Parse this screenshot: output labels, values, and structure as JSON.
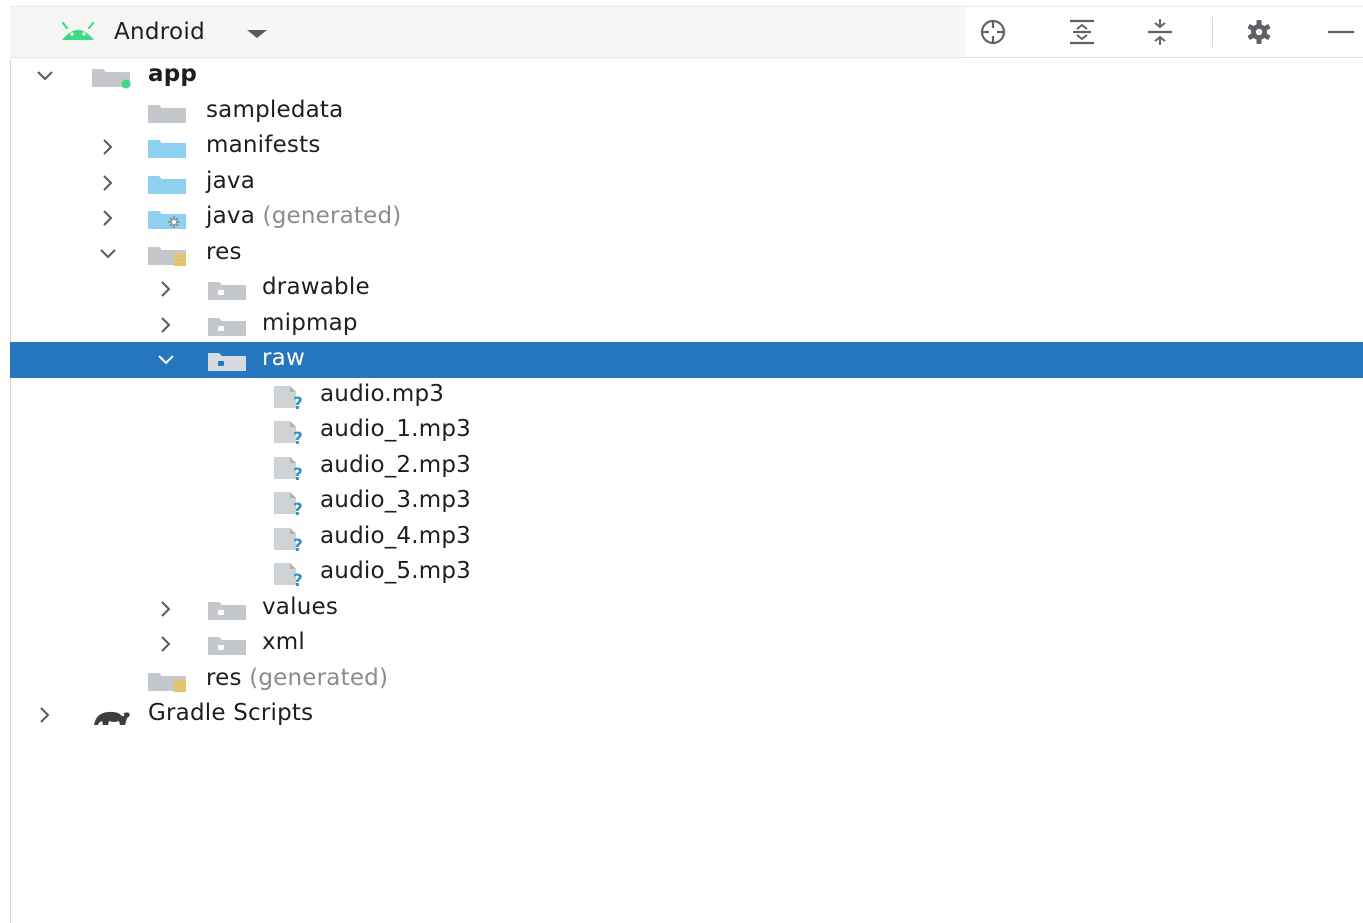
{
  "toolbar": {
    "view_selector_label": "Android",
    "icons": {
      "android": "android-icon",
      "locate": "locate-icon",
      "expand_all": "expand-all-icon",
      "collapse_all": "collapse-all-icon",
      "settings": "gear-icon",
      "hide": "minimize-icon"
    }
  },
  "colors": {
    "selection": "#2675bf",
    "android_green": "#3ddc84",
    "folder_blue": "#8dd0ef",
    "folder_gray": "#c4c8cc",
    "res_accent": "#f1c34c",
    "unknown_file_blue": "#3592c4"
  },
  "tree": {
    "items": [
      {
        "label": "app",
        "suffix": "",
        "depth": 0,
        "expanded": true,
        "icon": "module-folder-icon",
        "bold": true
      },
      {
        "label": "sampledata",
        "suffix": "",
        "depth": 1,
        "expanded": null,
        "icon": "folder-icon"
      },
      {
        "label": "manifests",
        "suffix": "",
        "depth": 1,
        "expanded": false,
        "icon": "source-folder-icon"
      },
      {
        "label": "java",
        "suffix": "",
        "depth": 1,
        "expanded": false,
        "icon": "source-folder-icon"
      },
      {
        "label": "java",
        "suffix": "(generated)",
        "depth": 1,
        "expanded": false,
        "icon": "generated-folder-icon"
      },
      {
        "label": "res",
        "suffix": "",
        "depth": 1,
        "expanded": true,
        "icon": "resource-folder-icon"
      },
      {
        "label": "drawable",
        "suffix": "",
        "depth": 2,
        "expanded": false,
        "icon": "package-folder-icon"
      },
      {
        "label": "mipmap",
        "suffix": "",
        "depth": 2,
        "expanded": false,
        "icon": "package-folder-icon"
      },
      {
        "label": "raw",
        "suffix": "",
        "depth": 2,
        "expanded": true,
        "icon": "package-folder-icon",
        "selected": true
      },
      {
        "label": "audio.mp3",
        "suffix": "",
        "depth": 3,
        "expanded": null,
        "icon": "unknown-file-icon"
      },
      {
        "label": "audio_1.mp3",
        "suffix": "",
        "depth": 3,
        "expanded": null,
        "icon": "unknown-file-icon"
      },
      {
        "label": "audio_2.mp3",
        "suffix": "",
        "depth": 3,
        "expanded": null,
        "icon": "unknown-file-icon"
      },
      {
        "label": "audio_3.mp3",
        "suffix": "",
        "depth": 3,
        "expanded": null,
        "icon": "unknown-file-icon"
      },
      {
        "label": "audio_4.mp3",
        "suffix": "",
        "depth": 3,
        "expanded": null,
        "icon": "unknown-file-icon"
      },
      {
        "label": "audio_5.mp3",
        "suffix": "",
        "depth": 3,
        "expanded": null,
        "icon": "unknown-file-icon"
      },
      {
        "label": "values",
        "suffix": "",
        "depth": 2,
        "expanded": false,
        "icon": "package-folder-icon"
      },
      {
        "label": "xml",
        "suffix": "",
        "depth": 2,
        "expanded": false,
        "icon": "package-folder-icon"
      },
      {
        "label": "res",
        "suffix": "(generated)",
        "depth": 1,
        "expanded": null,
        "icon": "resource-folder-icon"
      },
      {
        "label": "Gradle Scripts",
        "suffix": "",
        "depth": 0,
        "expanded": false,
        "icon": "gradle-icon"
      }
    ]
  }
}
